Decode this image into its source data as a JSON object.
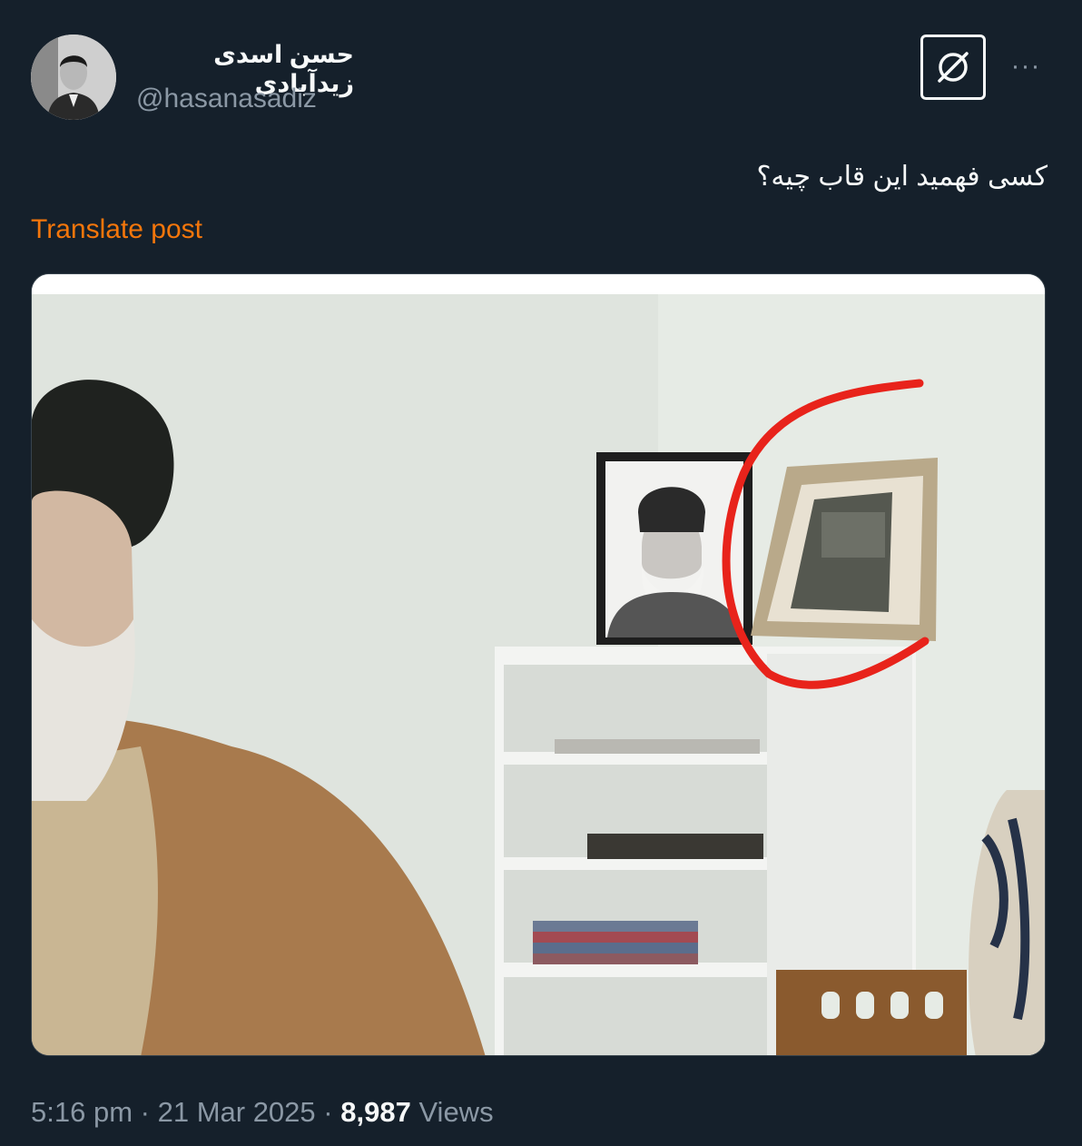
{
  "author": {
    "display_name": "حسن اسدی زیدآبادی",
    "handle": "@hasanasadiz",
    "avatar_icon": "profile-photo"
  },
  "actions": {
    "grok_icon": "grok-icon",
    "more_label": "···"
  },
  "post": {
    "text": "کسی فهمید این قاب چیه؟",
    "translate_label": "Translate post"
  },
  "media": {
    "description_icon": "photo-image"
  },
  "meta": {
    "time": "5:16 pm",
    "separator": "·",
    "date": "21 Mar 2025",
    "views_count": "8,987",
    "views_label": "Views"
  },
  "colors": {
    "background": "#15202b",
    "text": "#f7f9f9",
    "secondary": "#8b98a5",
    "translate": "#f4760b",
    "annotation": "#e8231b"
  }
}
